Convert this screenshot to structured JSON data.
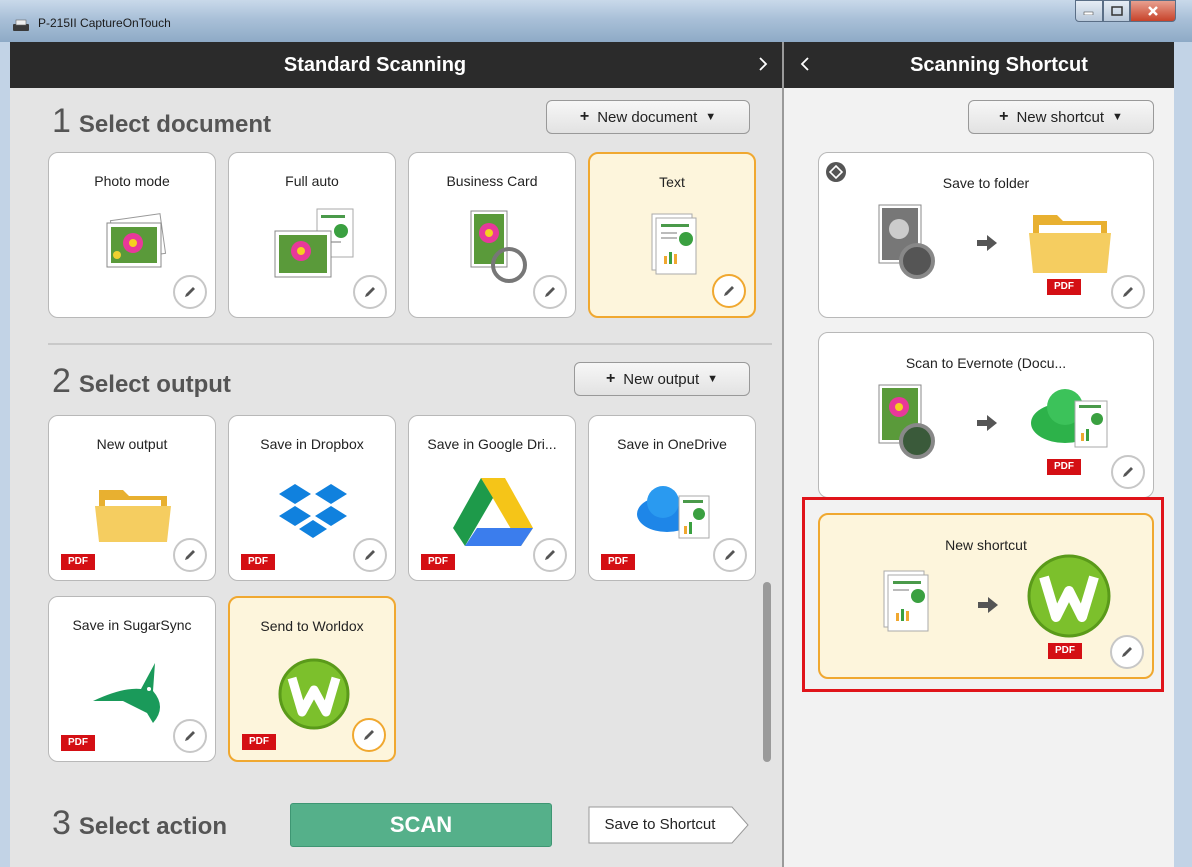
{
  "window": {
    "title": "P-215II CaptureOnTouch"
  },
  "standard": {
    "header": "Standard Scanning",
    "section1": {
      "number": "1",
      "title": "Select document",
      "new_button": "New document"
    },
    "documents": [
      {
        "label": "Photo mode",
        "selected": false
      },
      {
        "label": "Full auto",
        "selected": false
      },
      {
        "label": "Business Card",
        "selected": false
      },
      {
        "label": "Text",
        "selected": true
      }
    ],
    "section2": {
      "number": "2",
      "title": "Select output",
      "new_button": "New output"
    },
    "outputs": [
      {
        "label": "New output",
        "badge": "PDF",
        "selected": false
      },
      {
        "label": "Save in Dropbox",
        "badge": "PDF",
        "selected": false
      },
      {
        "label": "Save in Google Dri...",
        "badge": "PDF",
        "selected": false
      },
      {
        "label": "Save in OneDrive",
        "badge": "PDF",
        "selected": false
      },
      {
        "label": "Save in SugarSync",
        "badge": "PDF",
        "selected": false
      },
      {
        "label": "Send to Worldox",
        "badge": "PDF",
        "selected": true
      }
    ],
    "section3": {
      "number": "3",
      "title": "Select action"
    },
    "scan_button": "SCAN",
    "save_shortcut_button": "Save to Shortcut"
  },
  "shortcut": {
    "header": "Scanning Shortcut",
    "new_button": "New shortcut",
    "items": [
      {
        "label": "Save to folder",
        "badge": "PDF",
        "selected": false
      },
      {
        "label": "Scan to Evernote (Docu...",
        "badge": "PDF",
        "selected": false
      },
      {
        "label": "New shortcut",
        "badge": "PDF",
        "selected": true
      }
    ]
  },
  "colors": {
    "accent_selected_border": "#f0a830",
    "selected_bg": "#fdf5dc",
    "scan_green": "#55b08a",
    "pdf_red": "#d40f14",
    "highlight_red": "#e0141a",
    "header_dark": "#2b2b2b"
  },
  "icons": {
    "edit": "pencil-icon",
    "chevron_right": "chevron-right-icon",
    "chevron_left": "chevron-left-icon",
    "caret": "caret-down-icon",
    "plus": "plus-icon"
  }
}
